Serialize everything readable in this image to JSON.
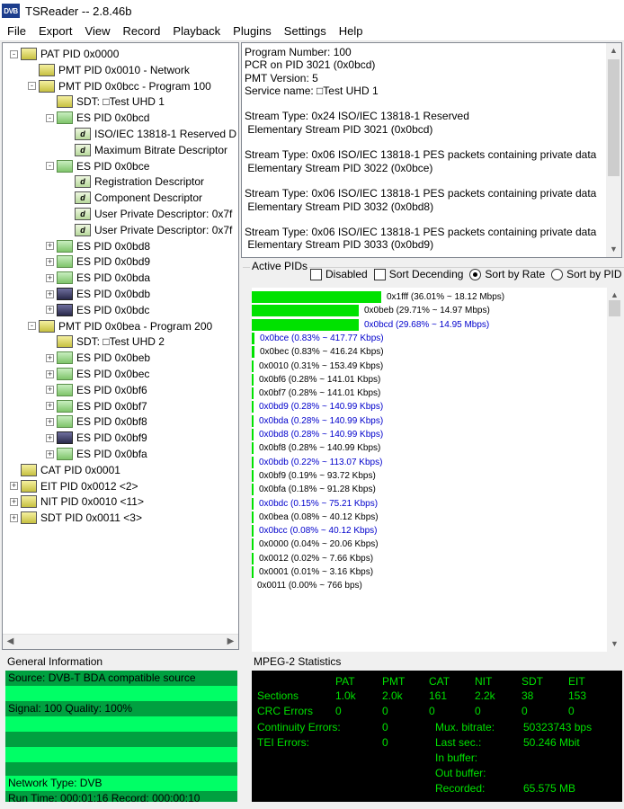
{
  "window": {
    "app_icon": "DVB",
    "title": "TSReader -- 2.8.46b"
  },
  "menu": [
    "File",
    "Export",
    "View",
    "Record",
    "Playback",
    "Plugins",
    "Settings",
    "Help"
  ],
  "tree": [
    {
      "label": "PAT PID 0x0000",
      "level": 0,
      "icon": "PAT",
      "exp": "-"
    },
    {
      "label": "PMT PID 0x0010 - Network",
      "level": 1,
      "icon": "PMT",
      "exp": ""
    },
    {
      "label": "PMT PID 0x0bcc - Program 100",
      "level": 1,
      "icon": "PMT",
      "exp": "-"
    },
    {
      "label": "SDT: □Test UHD 1",
      "level": 2,
      "icon": "SDT",
      "exp": ""
    },
    {
      "label": "ES PID 0x0bcd",
      "level": 2,
      "icon": "es",
      "exp": "-"
    },
    {
      "label": "ISO/IEC 13818-1 Reserved D",
      "level": 3,
      "icon": "d",
      "exp": ""
    },
    {
      "label": "Maximum Bitrate Descriptor",
      "level": 3,
      "icon": "d",
      "exp": ""
    },
    {
      "label": "ES PID 0x0bce",
      "level": 2,
      "icon": "es",
      "exp": "-"
    },
    {
      "label": "Registration Descriptor",
      "level": 3,
      "icon": "d",
      "exp": ""
    },
    {
      "label": "Component Descriptor",
      "level": 3,
      "icon": "d",
      "exp": ""
    },
    {
      "label": "User Private Descriptor: 0x7f",
      "level": 3,
      "icon": "d",
      "exp": ""
    },
    {
      "label": "User Private Descriptor: 0x7f",
      "level": 3,
      "icon": "d",
      "exp": ""
    },
    {
      "label": "ES PID 0x0bd8",
      "level": 2,
      "icon": "es",
      "exp": "+"
    },
    {
      "label": "ES PID 0x0bd9",
      "level": 2,
      "icon": "es",
      "exp": "+"
    },
    {
      "label": "ES PID 0x0bda",
      "level": 2,
      "icon": "es",
      "exp": "+"
    },
    {
      "label": "ES PID 0x0bdb",
      "level": 2,
      "icon": "es-dark",
      "exp": "+"
    },
    {
      "label": "ES PID 0x0bdc",
      "level": 2,
      "icon": "es-dark",
      "exp": "+"
    },
    {
      "label": "PMT PID 0x0bea - Program 200",
      "level": 1,
      "icon": "PMT",
      "exp": "-"
    },
    {
      "label": "SDT: □Test UHD 2",
      "level": 2,
      "icon": "SDT",
      "exp": ""
    },
    {
      "label": "ES PID 0x0beb",
      "level": 2,
      "icon": "es",
      "exp": "+"
    },
    {
      "label": "ES PID 0x0bec",
      "level": 2,
      "icon": "es",
      "exp": "+"
    },
    {
      "label": "ES PID 0x0bf6",
      "level": 2,
      "icon": "es",
      "exp": "+"
    },
    {
      "label": "ES PID 0x0bf7",
      "level": 2,
      "icon": "es",
      "exp": "+"
    },
    {
      "label": "ES PID 0x0bf8",
      "level": 2,
      "icon": "es",
      "exp": "+"
    },
    {
      "label": "ES PID 0x0bf9",
      "level": 2,
      "icon": "es-dark",
      "exp": "+"
    },
    {
      "label": "ES PID 0x0bfa",
      "level": 2,
      "icon": "es",
      "exp": "+"
    },
    {
      "label": "CAT PID 0x0001",
      "level": 0,
      "icon": "CAT",
      "exp": ""
    },
    {
      "label": "EIT PID 0x0012 <2>",
      "level": 0,
      "icon": "EIT",
      "exp": "+"
    },
    {
      "label": "NIT PID 0x0010 <11>",
      "level": 0,
      "icon": "NIT",
      "exp": "+"
    },
    {
      "label": "SDT PID 0x0011 <3>",
      "level": 0,
      "icon": "SDT",
      "exp": "+"
    }
  ],
  "info_lines": [
    "Program Number: 100",
    "PCR on PID 3021 (0x0bcd)",
    "PMT Version: 5",
    "Service name: □Test UHD 1",
    "",
    "Stream Type: 0x24 ISO/IEC 13818-1 Reserved",
    " Elementary Stream PID 3021 (0x0bcd)",
    "",
    "Stream Type: 0x06 ISO/IEC 13818-1 PES packets containing private data",
    " Elementary Stream PID 3022 (0x0bce)",
    "",
    "Stream Type: 0x06 ISO/IEC 13818-1 PES packets containing private data",
    " Elementary Stream PID 3032 (0x0bd8)",
    "",
    "Stream Type: 0x06 ISO/IEC 13818-1 PES packets containing private data",
    " Elementary Stream PID 3033 (0x0bd9)"
  ],
  "active_pids": {
    "legend": "Active PIDs",
    "disabled_label": "Disabled",
    "sort_desc_label": "Sort Decending",
    "sort_rate_label": "Sort by Rate",
    "sort_pid_label": "Sort by PID",
    "sort_selected": "rate",
    "bar_color": "#00e200",
    "rows": [
      {
        "label": "0x1fff (36.01% ~ 18.12 Mbps)",
        "pct": 36.01,
        "blue": false
      },
      {
        "label": "0x0beb (29.71% ~ 14.97 Mbps)",
        "pct": 29.71,
        "blue": false
      },
      {
        "label": "0x0bcd (29.68% ~ 14.95 Mbps)",
        "pct": 29.68,
        "blue": true
      },
      {
        "label": "0x0bce (0.83% ~ 417.77 Kbps)",
        "pct": 0.83,
        "blue": true
      },
      {
        "label": "0x0bec (0.83% ~ 416.24 Kbps)",
        "pct": 0.83,
        "blue": false
      },
      {
        "label": "0x0010 (0.31% ~ 153.49 Kbps)",
        "pct": 0.31,
        "blue": false
      },
      {
        "label": "0x0bf6 (0.28% ~ 141.01 Kbps)",
        "pct": 0.28,
        "blue": false
      },
      {
        "label": "0x0bf7 (0.28% ~ 141.01 Kbps)",
        "pct": 0.28,
        "blue": false
      },
      {
        "label": "0x0bd9 (0.28% ~ 140.99 Kbps)",
        "pct": 0.28,
        "blue": true
      },
      {
        "label": "0x0bda (0.28% ~ 140.99 Kbps)",
        "pct": 0.28,
        "blue": true
      },
      {
        "label": "0x0bd8 (0.28% ~ 140.99 Kbps)",
        "pct": 0.28,
        "blue": true
      },
      {
        "label": "0x0bf8 (0.28% ~ 140.99 Kbps)",
        "pct": 0.28,
        "blue": false
      },
      {
        "label": "0x0bdb (0.22% ~ 113.07 Kbps)",
        "pct": 0.22,
        "blue": true
      },
      {
        "label": "0x0bf9 (0.19% ~ 93.72 Kbps)",
        "pct": 0.19,
        "blue": false
      },
      {
        "label": "0x0bfa (0.18% ~ 91.28 Kbps)",
        "pct": 0.18,
        "blue": false
      },
      {
        "label": "0x0bdc (0.15% ~ 75.21 Kbps)",
        "pct": 0.15,
        "blue": true
      },
      {
        "label": "0x0bea (0.08% ~ 40.12 Kbps)",
        "pct": 0.08,
        "blue": false
      },
      {
        "label": "0x0bcc (0.08% ~ 40.12 Kbps)",
        "pct": 0.08,
        "blue": true
      },
      {
        "label": "0x0000 (0.04% ~ 20.06 Kbps)",
        "pct": 0.04,
        "blue": false
      },
      {
        "label": "0x0012 (0.02% ~ 7.66 Kbps)",
        "pct": 0.02,
        "blue": false
      },
      {
        "label": "0x0001 (0.01% ~ 3.16 Kbps)",
        "pct": 0.01,
        "blue": false
      },
      {
        "label": "0x0011 (0.00% ~ 766 bps)",
        "pct": 0.0,
        "blue": false
      }
    ]
  },
  "general_info": {
    "legend": "General Information",
    "source": "Source: DVB-T BDA compatible source",
    "signal": "Signal: 100 Quality: 100%",
    "network_type": "Network Type: DVB",
    "run_time": "Run Time: 000:01:16 Record: 000:00:10"
  },
  "mpeg_stats": {
    "legend": "MPEG-2 Statistics",
    "columns": [
      "PAT",
      "PMT",
      "CAT",
      "NIT",
      "SDT",
      "EIT"
    ],
    "sections_label": "Sections",
    "sections": [
      "1.0k",
      "2.0k",
      "161",
      "2.2k",
      "38",
      "153"
    ],
    "crc_label": "CRC Errors",
    "crc": [
      "0",
      "0",
      "0",
      "0",
      "0",
      "0"
    ],
    "continuity_label": "Continuity Errors:",
    "continuity": "0",
    "tei_label": "TEI Errors:",
    "tei": "0",
    "mux_label": "Mux. bitrate:",
    "mux": "50323743 bps",
    "last_sec_label": "Last sec.:",
    "last_sec": "50.246 Mbit",
    "in_buffer_label": "In buffer:",
    "out_buffer_label": "Out buffer:",
    "recorded_label": "Recorded:",
    "recorded": "65.575 MB",
    "text_color": "#00e000"
  }
}
